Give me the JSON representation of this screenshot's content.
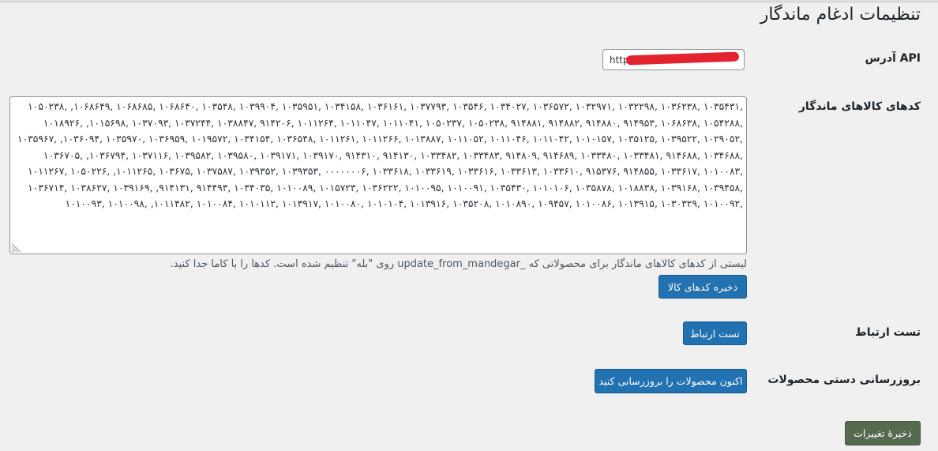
{
  "page": {
    "title": "تنظیمات ادغام ماندگار"
  },
  "api": {
    "label": "آدرس API",
    "value": "http://"
  },
  "codes": {
    "label": "کدهای کالاهای ماندگار",
    "value": ",۱۰۳۵۴۳۱ ,۱۰۳۶۲۳۸ ,۱۰۳۲۲۹۸ ,۱۰۳۲۹۷۱ ,۱۰۳۶۵۷۲ ,۱۰۳۴۰۲۷ ,۱۰۳۵۴۶ ,۱۰۳۷۷۹۳ ,۱۰۳۶۱۶۱ ,۱۰۳۴۱۵۸ ,۱۰۳۵۹۵۱ ,۱۰۳۹۹۰۴ ,۱۰۳۵۴۸ ,۱۰۶۸۶۴۰ ,۱۰۶۸۶۸۵ ,۱۰۶۸۶۴۹, ,۱۰۵۰۲۳۸ ,۱۰۵۴۲۸۸ ,۱۰۶۸۶۳۸ ,۹۱۴۹۵۳ ,۹۱۴۸۸۰ ,۹۱۴۸۸۲ ,۹۱۴۸۸۱ ,۱۰۵۰۲۳۸ ,۱۰۵۰۲۳۷ ,۱۰۱۱۰۴۱ ,۱۰۱۱۰۴۷ ,۱۰۱۱۲۶۴ ,۹۱۴۲۰۶ ,۱۰۳۸۸۴۷ ,۱۰۳۷۲۴۴ ,۱۰۳۷۰۹۳ ,۱۰۱۵۶۹۸, ,۱۰۱۸۹۲۶ ,۱۰۲۹۰۵۲ ,۱۰۳۹۵۲۲ ,۱۰۳۵۱۲۵ ,۱۰۱۰۱۵۷ ,۱۰۱۱۰۴۲ ,۱۰۱۱۰۴۶ ,۱۰۱۱۰۵۲ ,۱۰۱۳۸۸۷ ,۱۰۱۱۲۶۶ ,۱۰۱۱۲۶۱ ,۱۰۳۶۵۴۸ ,۱۰۳۴۱۵۴ ,۱۰۱۹۵۷۲ ,۱۰۳۶۹۵۹ ,۱۰۳۵۹۷۰ ,۱۰۳۶۰۹۴, ,۱۰۳۵۹۶۷ ,۱۰۳۴۶۸۸ ,۹۱۴۶۸۸ ,۱۰۳۳۴۸۱ ,۱۰۳۳۴۸۰ ,۹۱۴۶۸۹ ,۹۱۴۸۰۹ ,۱۰۳۳۴۸۳ ,۱۰۳۳۴۸۲ ,۹۱۴۱۳۰ ,۹۱۴۳۱۰ ,۱۰۳۹۱۷۰ ,۱۰۳۹۱۷۱ ,۱۰۳۹۵۸۰ ,۱۰۳۹۵۸۲ ,۱۰۳۷۱۱۶ ,۱۰۳۶۷۹۴, ,۱۰۳۶۷۰۵ ,۱۰۱۰۰۸۳ ,۱۰۳۳۶۱۷ ,۹۱۴۸۵۵ ,۹۱۵۳۷۶ ,۱۰۳۳۶۱۰ ,۱۰۳۳۶۱۳ ,۱۰۳۳۶۱۶ ,۱۰۳۳۶۱۹ ,۱۰۳۳۶۱۸ ,۰۰۰۰۰۰۰۶ ,۱۰۳۹۳۵۳ ,۱۰۳۹۳۵۲ ,۱۰۳۷۵۸۷ ,۱۰۳۶۷۵ ,۱۰۱۱۲۶۵, ,۱۰۵۰۲۲۶ ,۱۰۱۱۲۶۷ ,۱۰۳۹۴۵۸ ,۱۰۳۹۱۶۸ ,۱۰۱۸۸۳۸ ,۱۰۳۵۸۷۸ ,۱۰۱۰۱۰۶ ,۱۰۳۵۴۳۰ ,۱۰۱۰۰۹۱ ,۱۰۱۰۰۹۵ ,۱۰۳۶۲۲۲ ,۱۰۱۵۷۲۳ ,۱۰۱۰۰۸۹ ,۱۰۳۴۰۳۵ ,۹۱۴۴۹۳ ,۹۱۴۱۳۱, ,۱۰۳۹۱۶۹ ,۱۰۳۸۶۲۷ ,۱۰۳۶۷۱۴ ,۱۰۱۰۰۹۲ ,۱۰۳۰۳۲۹ ,۱۰۱۳۹۱۵ ,۱۰۱۰۰۸۶ ,۱۰۹۴۵۷ ,۱۰۱۰۸۹۰ ,۱۰۳۵۲۰۸ ,۱۰۱۳۹۱۶ ,۱۰۱۰۱۰۴ ,۱۰۱۰۰۸۰ ,۱۰۱۳۹۱۷ ,۱۰۱۰۱۱۲ ,۱۰۱۰۰۸۴ ,۱۰۱۱۴۸۲, ,۱۰۱۰۰۹۸ ,۱۰۱۰۰۹۳",
    "help": "لیستی از کدهای کالاهای ماندگار برای محصولاتی که _update_from_mandegar روی \"بله\" تنظیم شده است. کدها را با کاما جدا کنید.",
    "save_button": "ذخیره کدهای کالا"
  },
  "test": {
    "label": "تست ارتباط",
    "button": "تست ارتباط"
  },
  "manual": {
    "label": "بروزرسانی دستی محصولات",
    "button": "اکنون محصولات را بروزرسانی کنید"
  },
  "footer": {
    "save_button": "ذخیرهٔ تغییرات"
  }
}
